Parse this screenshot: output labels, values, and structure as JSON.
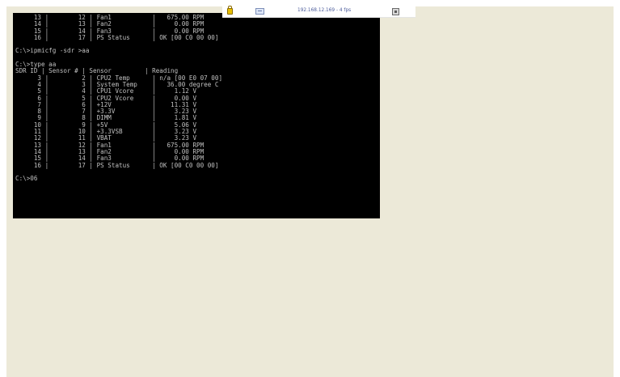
{
  "console": {
    "lines": [
      "     13 |        12 | Fan1           |   675.00 RPM",
      "     14 |        13 | Fan2           |     0.00 RPM",
      "     15 |        14 | Fan3           |     0.00 RPM",
      "     16 |        17 | PS Status      | OK [00 C0 00 00]",
      "",
      "C:\\>ipmicfg -sdr >aa",
      "",
      "C:\\>type aa",
      "SDR ID | Sensor # | Sensor         | Reading",
      "      3 |         2 | CPU2 Temp      | n/a [00 E0 07 00]",
      "      4 |         3 | System Temp    |   36.00 degree C",
      "      5 |         4 | CPU1 Vcore     |     1.12 V",
      "      6 |         5 | CPU2 Vcore     |     0.00 V",
      "      7 |         6 | +12V           |    11.31 V",
      "      8 |         7 | +3.3V          |     3.23 V",
      "      9 |         8 | DIMM           |     1.81 V",
      "     10 |         9 | +5V            |     5.06 V",
      "     11 |        10 | +3.3VSB        |     3.23 V",
      "     12 |        11 | VBAT           |     3.23 V",
      "     13 |        12 | Fan1           |   675.00 RPM",
      "     14 |        13 | Fan2           |     0.00 RPM",
      "     15 |        14 | Fan3           |     0.00 RPM",
      "     16 |        17 | PS Status      | OK [00 C0 00 00]",
      "",
      "C:\\>06"
    ]
  },
  "remote_bar": {
    "connection_text": "192.168.12.169 -  4 fps",
    "icons": [
      "lock-icon",
      "keyboard-icon",
      "screenshot-icon"
    ]
  },
  "colors": {
    "console_bg": "#000000",
    "console_text": "#c0c0c0",
    "desktop_bg": "#ece9d8",
    "connection_text": "#4a5a9a"
  }
}
